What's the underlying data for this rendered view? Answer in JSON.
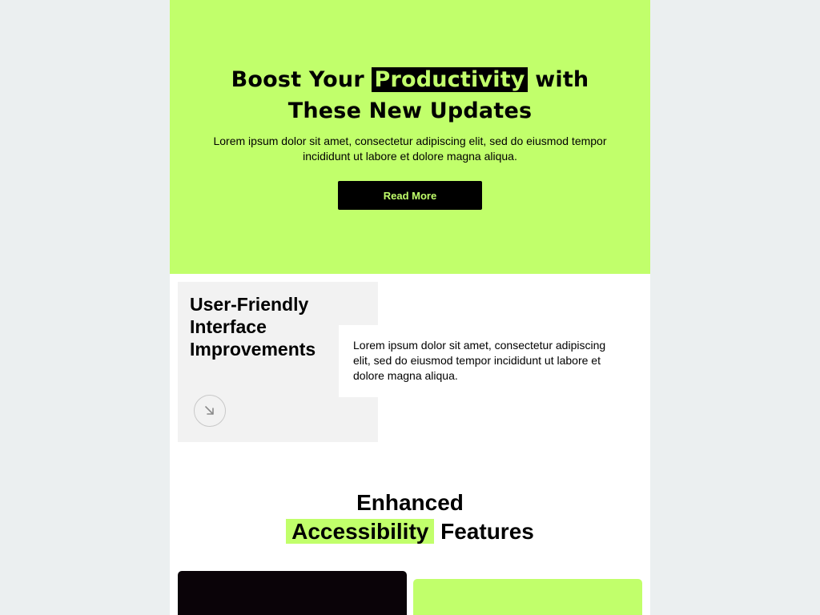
{
  "hero": {
    "title_before": "Boost Your",
    "title_highlight": "Productivity",
    "title_after": "with These New Updates",
    "description": "Lorem ipsum dolor sit amet, consectetur adipiscing elit, sed do eiusmod tempor incididunt ut labore et dolore magna aliqua.",
    "button_label": "Read More"
  },
  "feature": {
    "title": "User-Friendly Interface Improvements",
    "description": "Lorem ipsum dolor sit amet, consectetur adipiscing elit, sed do eiusmod tempor incididunt ut labore et dolore magna aliqua.",
    "arrow_icon": "arrow-down-right-icon"
  },
  "accessibility": {
    "title_line1": "Enhanced",
    "title_highlight": "Accessibility",
    "title_after": "Features"
  },
  "colors": {
    "background": "#ebeff0",
    "accent": "#c1ff6b",
    "dark": "#000000",
    "card_gray": "#f2f2f2"
  }
}
